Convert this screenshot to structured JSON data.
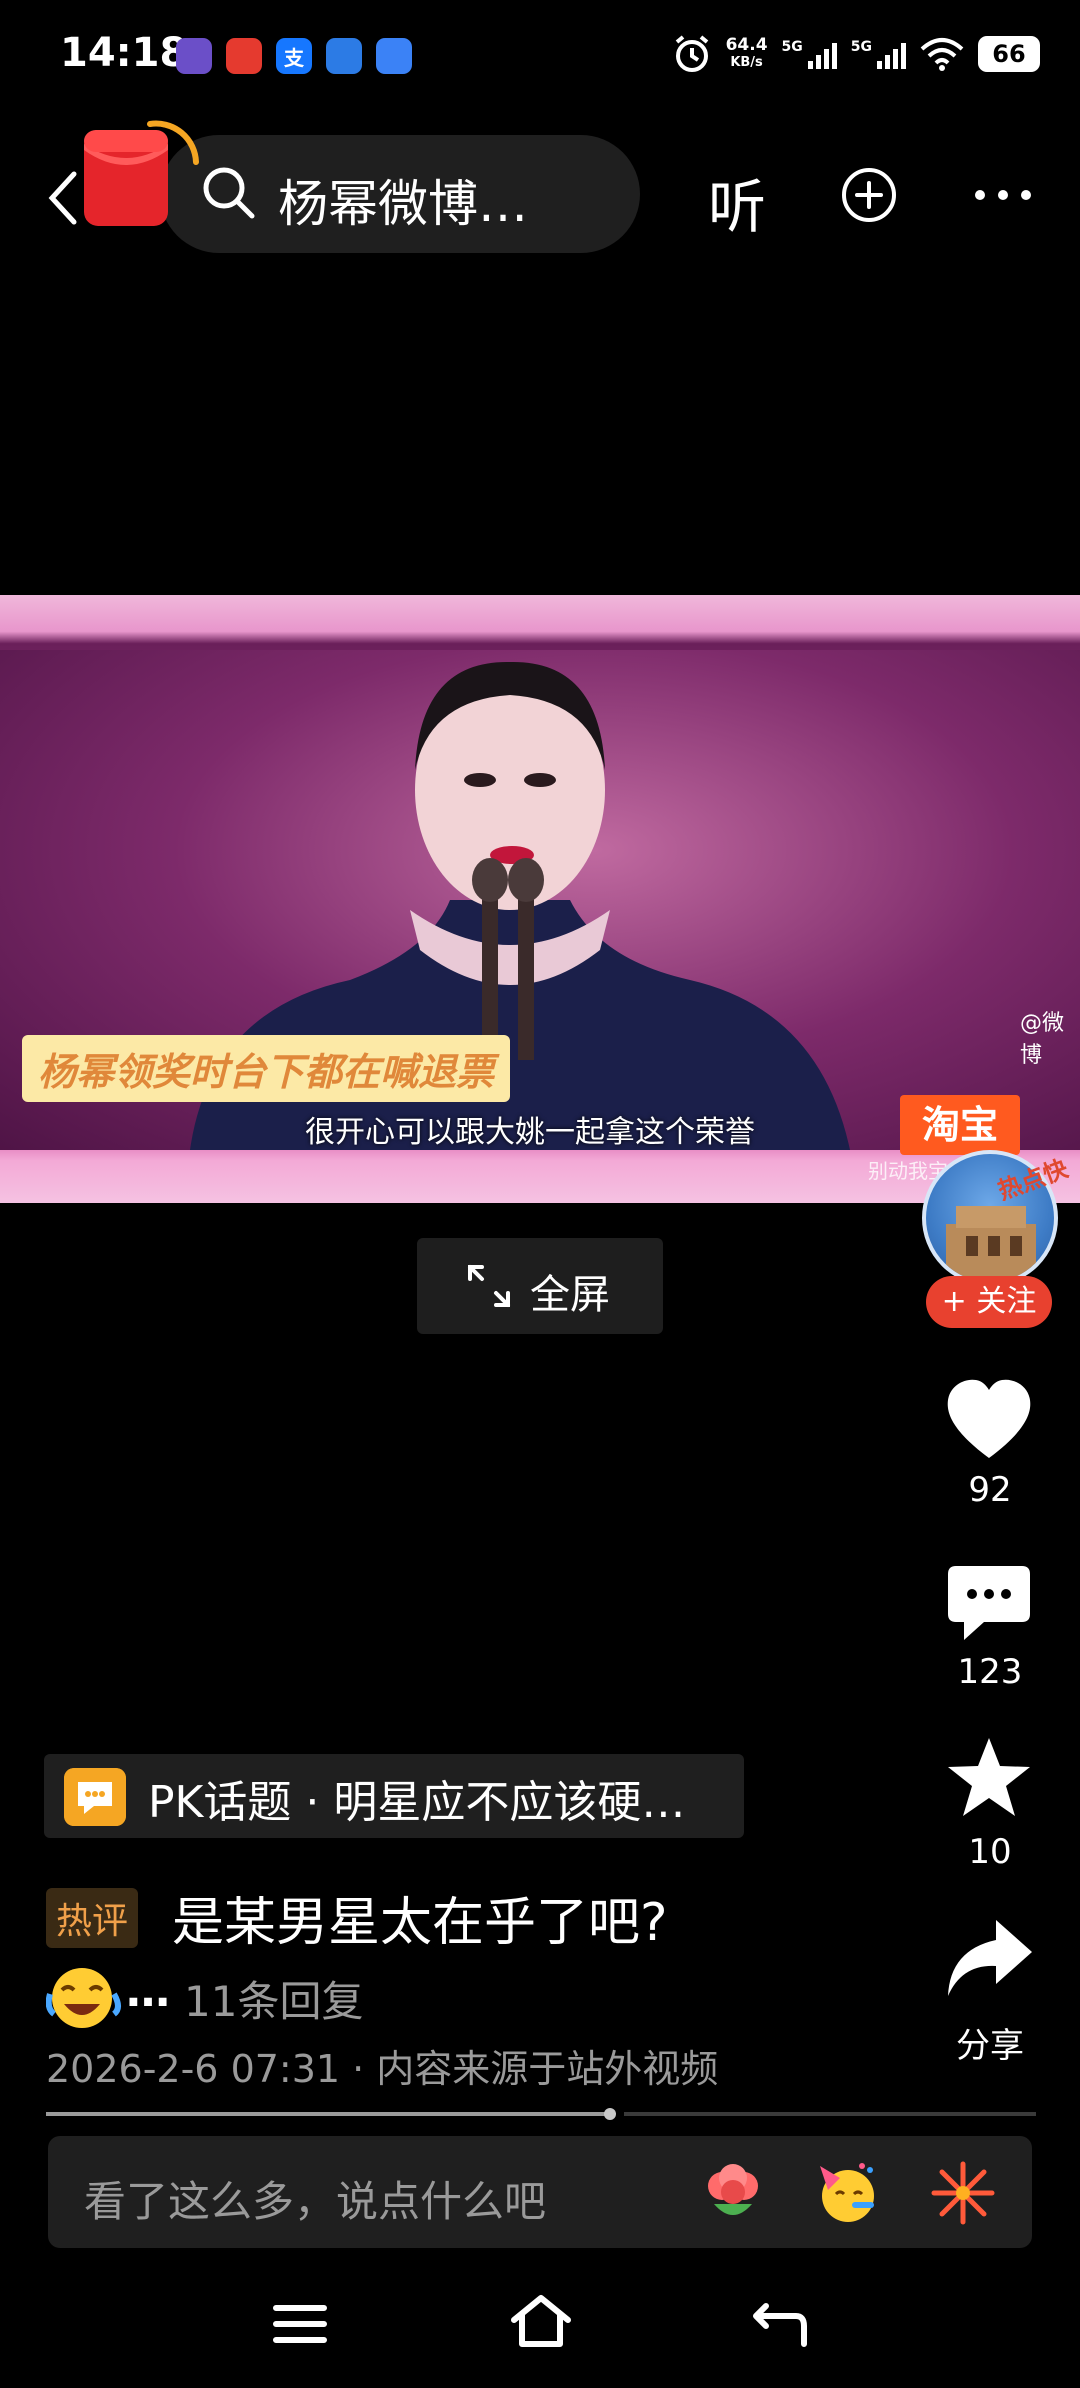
{
  "status_bar": {
    "time": "14:18",
    "net_speed_value": "64.4",
    "net_speed_unit": "KB/s",
    "signal_1_label": "5G",
    "signal_2_label": "5G",
    "battery": "66",
    "app_icons": [
      "app-purple-icon",
      "app-red-icon",
      "alipay-icon",
      "app-blue-icon",
      "app-notes-icon"
    ],
    "alipay_glyph": "支"
  },
  "top_nav": {
    "search_text": "杨幂微博…",
    "listen_label": "听"
  },
  "video": {
    "caption": "杨幂领奖时台下都在喊退票",
    "subtitle": "很开心可以跟大姚一起拿这个荣誉",
    "brand_badge": "淘宝",
    "watermark_top": "@微博",
    "watermark_bottom": "别动我宝贝"
  },
  "fullscreen": {
    "label": "全屏"
  },
  "author": {
    "avatar_tag": "热点快",
    "follow_label": "+ 关注"
  },
  "actions": {
    "like_count": "92",
    "comment_count": "123",
    "favorite_count": "10",
    "share_label": "分享"
  },
  "post": {
    "topic_label": "PK话题 · 明星应不应该硬…",
    "hot_badge": "热评",
    "top_comment": "是某男星太在乎了吧?",
    "ellipsis": "…",
    "replies": "11条回复",
    "meta": "2026-2-6 07:31 · 内容来源于站外视频"
  },
  "playback": {
    "progress_fraction": 0.57
  },
  "comment_box": {
    "placeholder": "看了这么多，说点什么吧",
    "emojis": [
      "flower-emoji-icon",
      "party-emoji-icon",
      "firework-emoji-icon"
    ]
  },
  "colors": {
    "accent_red": "#e8412f",
    "hot_orange": "#f0a04a",
    "topic_yellow": "#f5a623"
  }
}
